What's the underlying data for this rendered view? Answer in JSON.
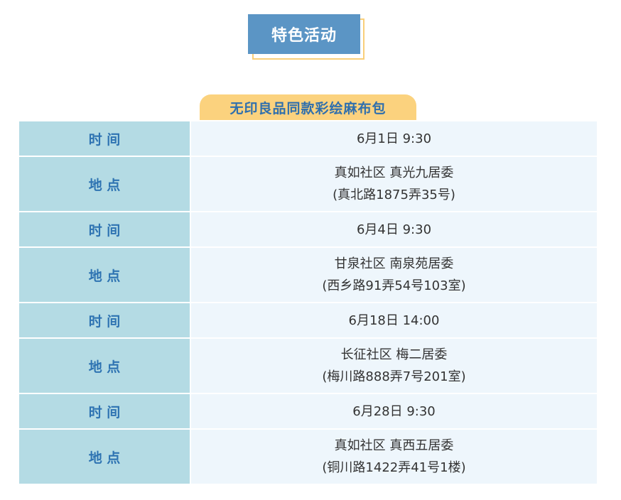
{
  "header": {
    "title": "特色活动"
  },
  "event": {
    "title": "无印良品同款彩绘麻布包",
    "rows": [
      {
        "label": "时 间",
        "line1": "6月1日 9:30",
        "line2": ""
      },
      {
        "label": "地 点",
        "line1": "真如社区 真光九居委",
        "line2": "(真北路1875弄35号)"
      },
      {
        "label": "时 间",
        "line1": "6月4日 9:30",
        "line2": ""
      },
      {
        "label": "地 点",
        "line1": "甘泉社区 南泉苑居委",
        "line2": "(西乡路91弄54号103室)"
      },
      {
        "label": "时 间",
        "line1": "6月18日 14:00",
        "line2": ""
      },
      {
        "label": "地 点",
        "line1": "长征社区 梅二居委",
        "line2": "(梅川路888弄7号201室)"
      },
      {
        "label": "时 间",
        "line1": "6月28日 9:30",
        "line2": ""
      },
      {
        "label": "地 点",
        "line1": "真如社区 真西五居委",
        "line2": "(铜川路1422弄41号1楼)"
      }
    ]
  }
}
